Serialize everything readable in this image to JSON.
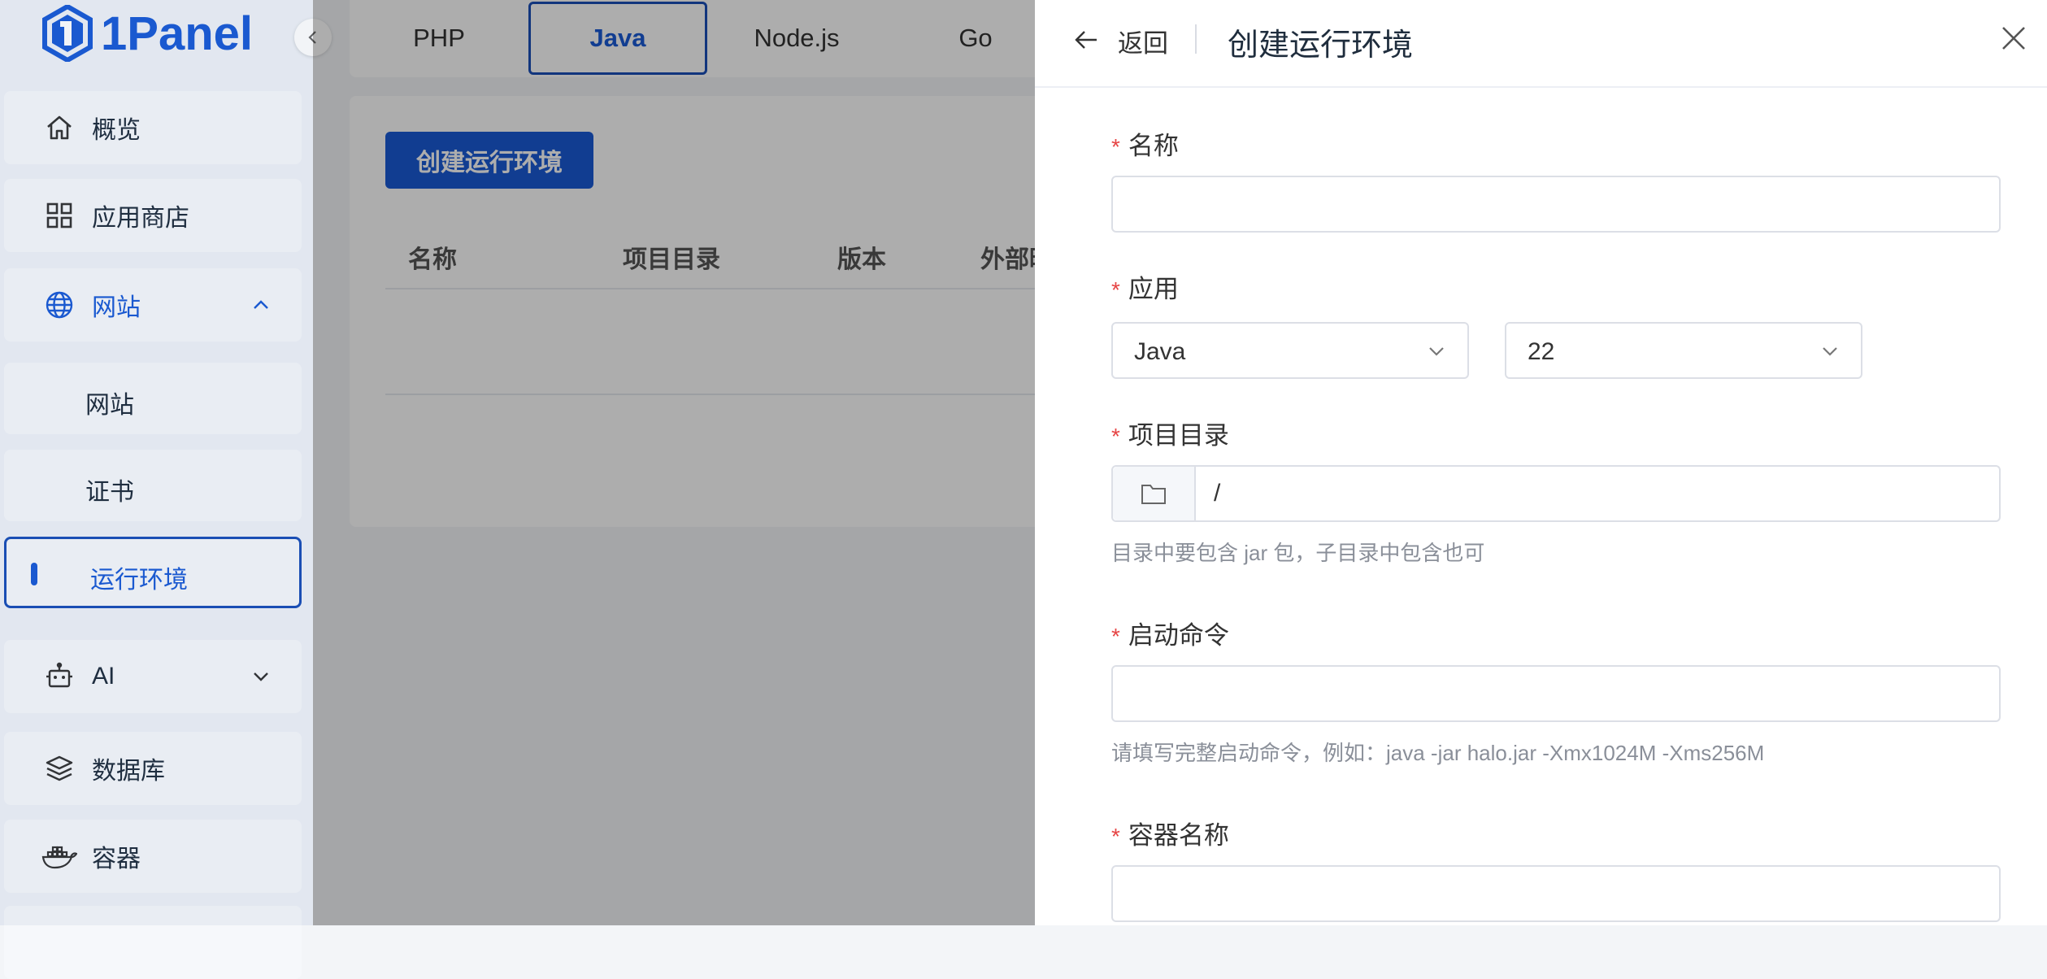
{
  "brand": {
    "name": "1Panel",
    "color": "#1a5bd6"
  },
  "sidebar": {
    "items": [
      {
        "label": "概览",
        "icon": "home-icon"
      },
      {
        "label": "应用商店",
        "icon": "grid-icon"
      },
      {
        "label": "网站",
        "icon": "globe-icon",
        "expanded": true
      },
      {
        "label": "网站"
      },
      {
        "label": "证书"
      },
      {
        "label": "运行环境",
        "selected": true
      },
      {
        "label": "AI",
        "icon": "robot-icon",
        "expanded": false
      },
      {
        "label": "数据库",
        "icon": "layers-icon"
      },
      {
        "label": "容器",
        "icon": "docker-icon"
      }
    ]
  },
  "tabs": [
    "PHP",
    "Java",
    "Node.js",
    "Go"
  ],
  "active_tab": "Java",
  "toolbar": {
    "create_label": "创建运行环境"
  },
  "table": {
    "columns": [
      "名称",
      "项目目录",
      "版本",
      "外部映"
    ]
  },
  "drawer": {
    "back_label": "返回",
    "title": "创建运行环境",
    "fields": {
      "name": {
        "label": "名称",
        "value": ""
      },
      "app": {
        "label": "应用",
        "app_value": "Java",
        "version_value": "22"
      },
      "dir": {
        "label": "项目目录",
        "value": "/",
        "hint": "目录中要包含 jar 包，子目录中包含也可"
      },
      "cmd": {
        "label": "启动命令",
        "value": "",
        "hint": "请填写完整启动命令，例如：java -jar halo.jar -Xmx1024M -Xms256M"
      },
      "container": {
        "label": "容器名称",
        "value": ""
      }
    }
  }
}
